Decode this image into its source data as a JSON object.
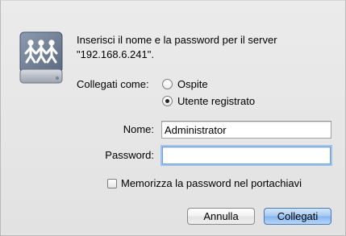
{
  "dialog": {
    "icon": "network-server-icon",
    "prompt_line1": "Inserisci il nome e la password per il server",
    "prompt_line2": "\"192.168.6.241\".",
    "connect_as_label": "Collegati come:",
    "radio_guest_label": "Ospite",
    "radio_registered_label": "Utente registrato",
    "selected_option": "Utente registrato",
    "name_label": "Nome:",
    "name_value": "Administrator",
    "password_label": "Password:",
    "password_value": "",
    "remember_label": "Memorizza la password nel portachiavi",
    "remember_checked": false,
    "cancel_label": "Annulla",
    "connect_label": "Collegati"
  },
  "colors": {
    "window_background": "#e8e8e8",
    "default_button": "#a6c9f1",
    "focus_ring": "#9ec3ee"
  }
}
